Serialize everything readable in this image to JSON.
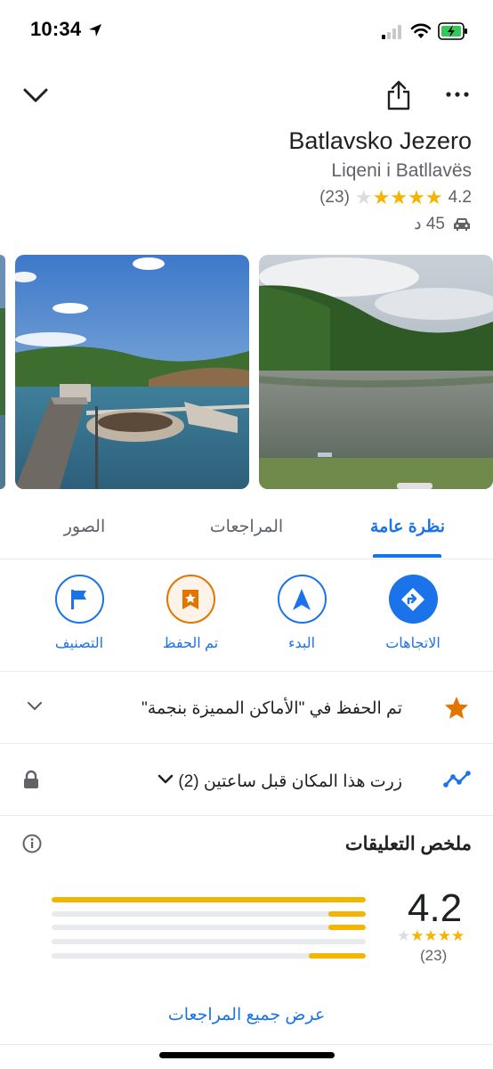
{
  "status_bar": {
    "time": "10:34"
  },
  "place": {
    "name": "Batlavsko Jezero",
    "alt_name": "Liqeni i Batllavës",
    "rating": "4.2",
    "review_count": "(23)",
    "stars_filled": 4,
    "drive_time": "45 د"
  },
  "tabs": [
    {
      "label": "نظرة عامة",
      "active": true
    },
    {
      "label": "المراجعات",
      "active": false
    },
    {
      "label": "الصور",
      "active": false
    }
  ],
  "actions": {
    "directions": "الاتجاهات",
    "start": "البدء",
    "saved": "تم الحفظ",
    "label": "التصنيف"
  },
  "saved_row": {
    "text": "تم الحفظ في \"الأماكن المميزة بنجمة\""
  },
  "visit_row": {
    "text": "زرت هذا المكان قبل ساعتين (2)"
  },
  "review_summary": {
    "heading": "ملخص التعليقات",
    "rating": "4.2",
    "count": "(23)",
    "bars": [
      1.0,
      0.12,
      0.12,
      0.0,
      0.18
    ],
    "all_reviews_label": "عرض جميع المراجعات"
  },
  "colors": {
    "accent": "#1a73e8",
    "star": "#f4b400",
    "saved": "#e37400"
  }
}
